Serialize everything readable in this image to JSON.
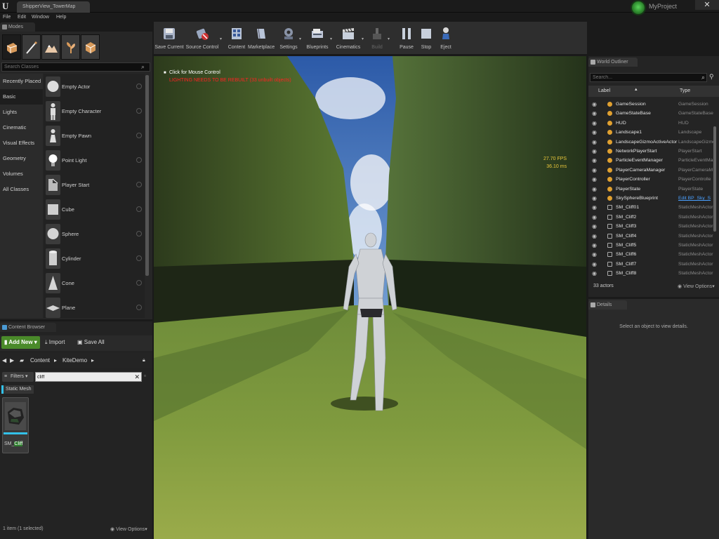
{
  "window": {
    "document_tab": "ShipperView_TowerMap",
    "project_name": "MyProject",
    "close_glyph": "✕"
  },
  "menu": [
    "File",
    "Edit",
    "Window",
    "Help"
  ],
  "modes": {
    "tab_title": "Modes",
    "search_placeholder": "Search Classes",
    "categories": [
      "Recently Placed",
      "Basic",
      "Lights",
      "Cinematic",
      "Visual Effects",
      "Geometry",
      "Volumes",
      "All Classes"
    ],
    "selected_category": "Basic",
    "place_items": [
      "Empty Actor",
      "Empty Character",
      "Empty Pawn",
      "Point Light",
      "Player Start",
      "Cube",
      "Sphere",
      "Cylinder",
      "Cone",
      "Plane"
    ]
  },
  "toolbar": {
    "buttons": [
      {
        "label": "Save Current",
        "icon": "save-icon",
        "enabled": true
      },
      {
        "label": "Source Control",
        "icon": "source-control-icon",
        "enabled": true
      },
      {
        "label": "Content",
        "icon": "content-icon",
        "enabled": true
      },
      {
        "label": "Marketplace",
        "icon": "marketplace-icon",
        "enabled": true
      },
      {
        "label": "Settings",
        "icon": "settings-icon",
        "enabled": true
      },
      {
        "label": "Blueprints",
        "icon": "blueprints-icon",
        "enabled": true
      },
      {
        "label": "Cinematics",
        "icon": "cinematics-icon",
        "enabled": true
      },
      {
        "label": "Build",
        "icon": "build-icon",
        "enabled": false
      },
      {
        "label": "Pause",
        "icon": "pause-icon",
        "enabled": true
      },
      {
        "label": "Stop",
        "icon": "stop-icon",
        "enabled": true
      },
      {
        "label": "Eject",
        "icon": "eject-icon",
        "enabled": true
      }
    ]
  },
  "viewport": {
    "hint": "Click for Mouse Control",
    "warning": "LIGHTING NEEDS TO BE REBUILT (33 unbuilt objects)",
    "fps": "27.70 FPS",
    "ms": "36.10 ms"
  },
  "content_browser": {
    "tab_title": "Content Browser",
    "add_new": "Add New",
    "import": "Import",
    "save_all": "Save All",
    "path": [
      "Content",
      "KiteDemo"
    ],
    "filters_label": "Filters",
    "search_value": "cliff",
    "filter_chip": "Static Mesh",
    "asset_label_prefix": "SM_",
    "asset_label_highlight": "Cliff",
    "status": "1 item (1 selected)",
    "view_options": "View Options"
  },
  "outliner": {
    "tab_title": "World Outliner",
    "search_placeholder": "Search...",
    "col_label": "Label",
    "col_type": "Type",
    "rows": [
      {
        "name": "GameSession",
        "type": "GameSession"
      },
      {
        "name": "GameStateBase",
        "type": "GameStateBase"
      },
      {
        "name": "HUD",
        "type": "HUD"
      },
      {
        "name": "Landscape1",
        "type": "Landscape"
      },
      {
        "name": "LandscapeGizmoActiveActor",
        "type": "LandscapeGizmo"
      },
      {
        "name": "NetworkPlayerStart",
        "type": "PlayerStart"
      },
      {
        "name": "ParticleEventManager",
        "type": "ParticleEventMa"
      },
      {
        "name": "PlayerCameraManager",
        "type": "PlayerCameraM"
      },
      {
        "name": "PlayerController",
        "type": "PlayerControlle"
      },
      {
        "name": "PlayerState",
        "type": "PlayerState"
      },
      {
        "name": "SkySphereBlueprint",
        "type": "Edit BP_Sky_S"
      },
      {
        "name": "SM_Cliff01",
        "type": "StaticMeshActor"
      },
      {
        "name": "SM_Cliff2",
        "type": "StaticMeshActor"
      },
      {
        "name": "SM_Cliff3",
        "type": "StaticMeshActor"
      },
      {
        "name": "SM_Cliff4",
        "type": "StaticMeshActor"
      },
      {
        "name": "SM_Cliff5",
        "type": "StaticMeshActor"
      },
      {
        "name": "SM_Cliff6",
        "type": "StaticMeshActor"
      },
      {
        "name": "SM_Cliff7",
        "type": "StaticMeshActor"
      },
      {
        "name": "SM_Cliff8",
        "type": "StaticMeshActor"
      }
    ],
    "actor_count": "33 actors",
    "view_options": "View Options"
  },
  "details": {
    "tab_title": "Details",
    "empty_message": "Select an object to view details."
  },
  "colors": {
    "accent_green": "#4a8a2a",
    "asset_blue": "#33c1e9",
    "warning_red": "#ff2222",
    "fps_yellow": "#e8c63a"
  }
}
